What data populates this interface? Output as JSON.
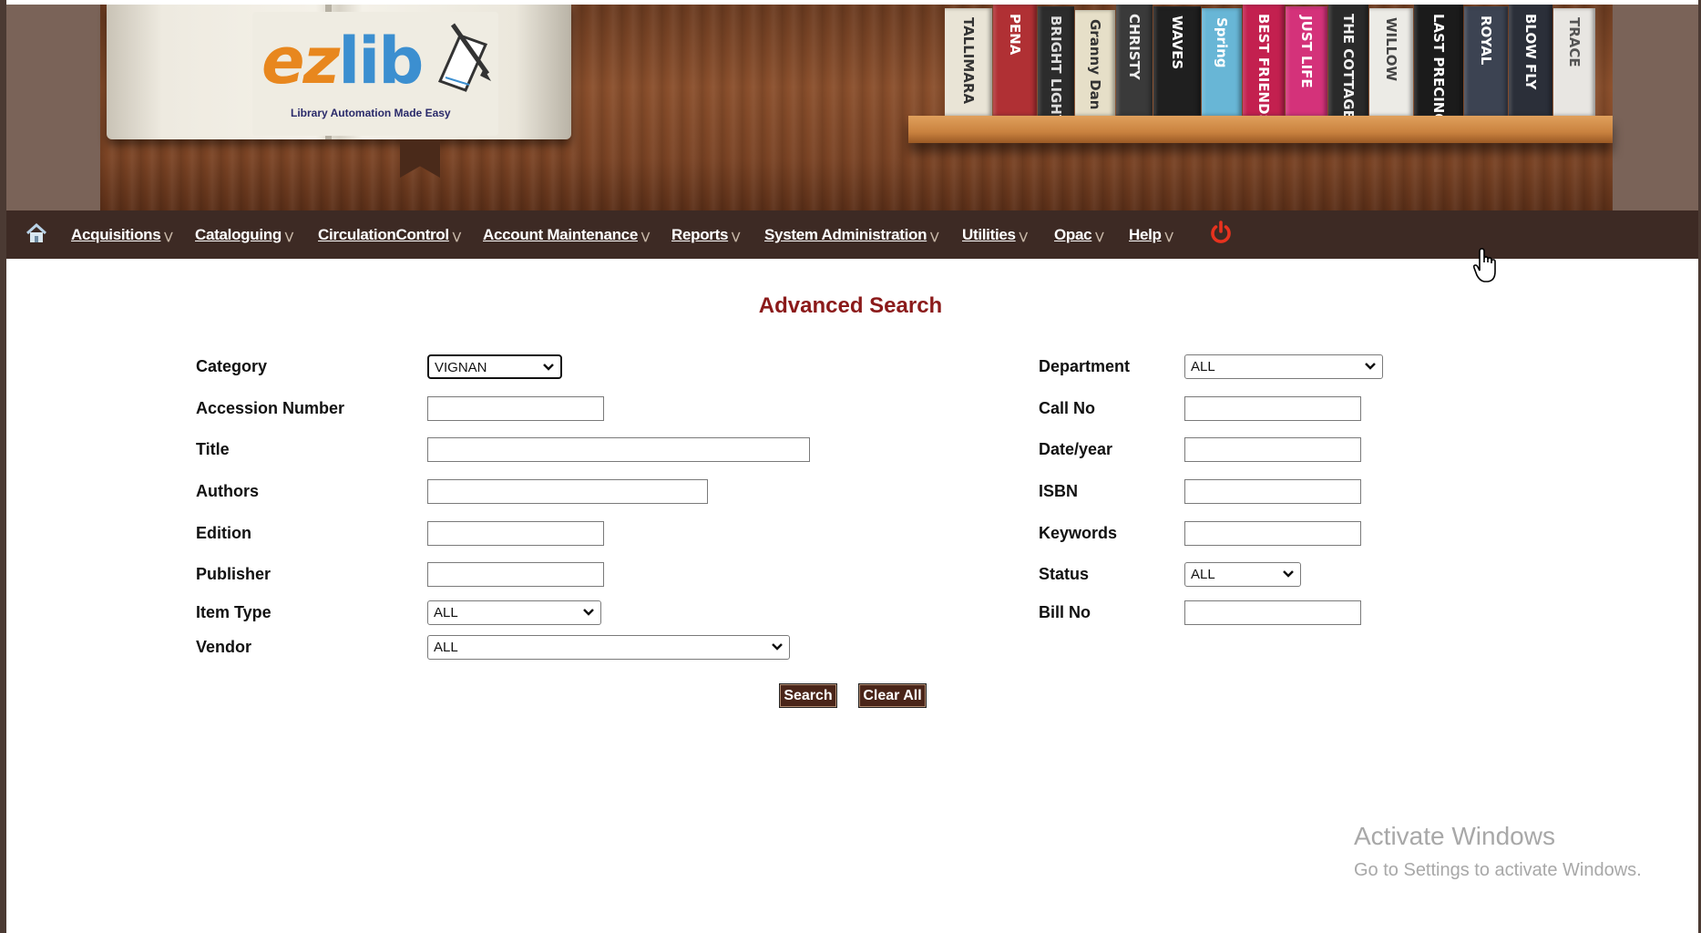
{
  "header": {
    "logo": {
      "word_ez": "ez",
      "word_lib": "lib",
      "tagline": "Library Automation Made Easy"
    },
    "book_spines": [
      {
        "text": "TALLIMARA",
        "color": "#e9e4d6",
        "text_color": "#333"
      },
      {
        "text": "PENA",
        "color": "#b03034",
        "text_color": "#fff"
      },
      {
        "text": "BRIGHT LIGHT",
        "color": "#2c2c2c",
        "text_color": "#ddd"
      },
      {
        "text": "Granny Dan",
        "color": "#e6dfc8",
        "text_color": "#333"
      },
      {
        "text": "CHRISTY",
        "color": "#3a3a3a",
        "text_color": "#eee"
      },
      {
        "text": "WAVES",
        "color": "#1f1f1f",
        "text_color": "#fff"
      },
      {
        "text": "Spring",
        "color": "#68b6d6",
        "text_color": "#fff"
      },
      {
        "text": "BEST FRIENDS",
        "color": "#c3204f",
        "text_color": "#fff"
      },
      {
        "text": "JUST LIFE",
        "color": "#d4327a",
        "text_color": "#fff"
      },
      {
        "text": "THE COTTAGE",
        "color": "#2a2a2a",
        "text_color": "#eee"
      },
      {
        "text": "WILLOW",
        "color": "#ecebe6",
        "text_color": "#444"
      },
      {
        "text": "LAST PRECINCT",
        "color": "#1b1b1b",
        "text_color": "#fff"
      },
      {
        "text": "ROYAL",
        "color": "#3c4352",
        "text_color": "#fff"
      },
      {
        "text": "BLOW FLY",
        "color": "#2b2f39",
        "text_color": "#fff"
      },
      {
        "text": "TRACE",
        "color": "#e8e6e2",
        "text_color": "#555"
      }
    ]
  },
  "nav": {
    "home_icon": "home-icon",
    "items": [
      {
        "label": "Acquisitions"
      },
      {
        "label": "Cataloguing"
      },
      {
        "label": "CirculationControl"
      },
      {
        "label": "Account Maintenance"
      },
      {
        "label": "Reports"
      },
      {
        "label": "System Administration"
      },
      {
        "label": "Utilities"
      },
      {
        "label": "Opac"
      },
      {
        "label": "Help"
      }
    ],
    "power_icon": "power-icon",
    "power_color": "#e8321e"
  },
  "page": {
    "title": "Advanced Search"
  },
  "form": {
    "left": {
      "category": {
        "label": "Category",
        "value": "VIGNAN"
      },
      "accession_number": {
        "label": "Accession Number",
        "value": ""
      },
      "title": {
        "label": "Title",
        "value": ""
      },
      "authors": {
        "label": "Authors",
        "value": ""
      },
      "edition": {
        "label": "Edition",
        "value": ""
      },
      "publisher": {
        "label": "Publisher",
        "value": ""
      },
      "item_type": {
        "label": "Item Type",
        "value": "ALL"
      },
      "vendor": {
        "label": "Vendor",
        "value": "ALL"
      }
    },
    "right": {
      "department": {
        "label": "Department",
        "value": "ALL"
      },
      "call_no": {
        "label": "Call No",
        "value": ""
      },
      "date_year": {
        "label": "Date/year",
        "value": ""
      },
      "isbn": {
        "label": "ISBN",
        "value": ""
      },
      "keywords": {
        "label": "Keywords",
        "value": ""
      },
      "status": {
        "label": "Status",
        "value": "ALL"
      },
      "bill_no": {
        "label": "Bill No",
        "value": ""
      }
    },
    "buttons": {
      "search": "Search",
      "clear_all": "Clear All"
    }
  },
  "watermark": {
    "title": "Activate Windows",
    "subtitle": "Go to Settings to activate Windows."
  },
  "colors": {
    "nav_bg": "#3d2a24",
    "title": "#8b1a1a",
    "button_bg": "#4a2519"
  }
}
